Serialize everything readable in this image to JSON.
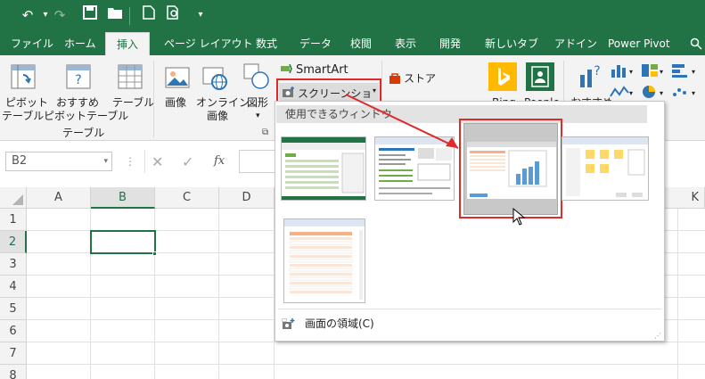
{
  "quick_access": {
    "undo": "↶",
    "redo": "↷",
    "save": "💾",
    "open": "📂",
    "new": "🗋",
    "preview": "🔍",
    "customize": "▾"
  },
  "tabs": [
    "ファイル",
    "ホーム",
    "挿入",
    "ページ レイアウト",
    "数式",
    "データ",
    "校閲",
    "表示",
    "開発",
    "新しいタブ",
    "アドイン",
    "Power Pivot"
  ],
  "active_tab": "挿入",
  "ribbon": {
    "pivot_table": [
      "ピボット",
      "テーブル"
    ],
    "recommended_pivot": [
      "おすすめ",
      "ピボットテーブル"
    ],
    "table": "テーブル",
    "group_table": "テーブル",
    "picture": "画像",
    "online_picture": [
      "オンライン",
      "画像"
    ],
    "shapes": "図形",
    "smartart": "SmartArt",
    "screenshot": "スクリーンショット",
    "store": "ストア",
    "bing": "Bing",
    "people": "People",
    "recommended_chart": "おすすめ"
  },
  "namebox": {
    "value": "B2",
    "fx": "fx"
  },
  "columns": [
    "A",
    "B",
    "C",
    "D",
    "K"
  ],
  "rows": [
    "1",
    "2",
    "3",
    "4",
    "5",
    "6",
    "7",
    "8"
  ],
  "dropdown": {
    "header": "使用できるウィンドウ",
    "screen_clipping": "画面の領域(C)"
  },
  "colors": {
    "excel_green": "#217346",
    "highlight_red": "#e02a2a"
  }
}
